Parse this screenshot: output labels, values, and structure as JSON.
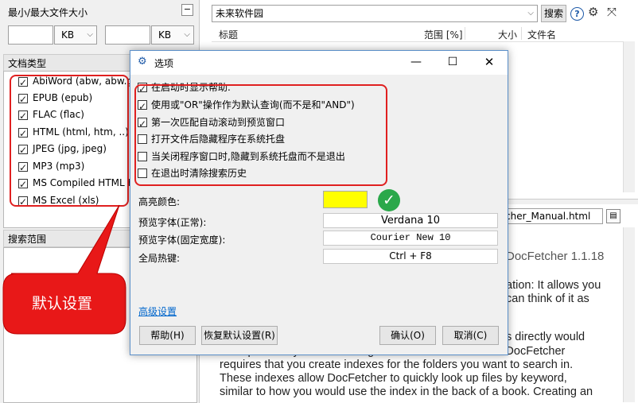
{
  "left": {
    "filesize_title": "最小/最大文件大小",
    "min_unit": "KB",
    "max_unit": "KB",
    "filetype_title": "文档类型",
    "filetypes": [
      {
        "label": "AbiWord (abw, abw.gz"
      },
      {
        "label": "EPUB (epub)"
      },
      {
        "label": "FLAC (flac)"
      },
      {
        "label": "HTML (html, htm, ..)"
      },
      {
        "label": "JPEG (jpg, jpeg)"
      },
      {
        "label": "MP3 (mp3)"
      },
      {
        "label": "MS Compiled HTML H"
      },
      {
        "label": "MS Excel (xls)"
      }
    ],
    "scope_title": "搜索范围"
  },
  "callout": {
    "text": "默认设置"
  },
  "search": {
    "query": "未来软件园",
    "button": "搜索",
    "help_icon": "?",
    "columns": {
      "title": "标题",
      "score": "范围 [%]",
      "size": "大小",
      "filename": "文件名"
    }
  },
  "preview": {
    "filename": "cher_Manual.html",
    "title_fragment": "DocFetcher 1.1.18",
    "lines": [
      "ation: It allows you",
      "can think of it as",
      "s directly would",
      "be impractically slow for a larger number of documents. DocFetcher",
      "requires that you create indexes for the folders you want to search in.",
      "These indexes allow DocFetcher to quickly look up files by keyword,",
      "similar to how you would use the index in the back of a book. Creating an"
    ]
  },
  "dialog": {
    "title": "选项",
    "options": [
      {
        "label": "在启动时显示帮助.",
        "checked": true
      },
      {
        "label": "使用或\"OR\"操作作为默认查询(而不是和\"AND\")",
        "checked": true
      },
      {
        "label": "第一次匹配自动滚动到预览窗口",
        "checked": true
      },
      {
        "label": "打开文件后隐藏程序在系统托盘",
        "checked": false
      },
      {
        "label": "当关闭程序窗口时,隐藏到系统托盘而不是退出",
        "checked": false
      },
      {
        "label": "在退出时清除搜索历史",
        "checked": false
      }
    ],
    "highlight_label": "高亮颜色:",
    "highlight_color": "#ffff00",
    "font_normal_label": "预览字体(正常):",
    "font_normal_value": "Verdana 10",
    "font_fixed_label": "预览字体(固定宽度):",
    "font_fixed_value": "Courier New 10",
    "hotkey_label": "全局热键:",
    "hotkey_value": "Ctrl + F8",
    "advanced_link": "高级设置",
    "help_button": "帮助(H)",
    "restore_button": "恢复默认设置(R)",
    "ok_button": "确认(O)",
    "cancel_button": "取消(C)"
  },
  "colors": {
    "accent_red": "#e02020",
    "callout_red": "#e81818",
    "check_green": "#2aa84a",
    "link_blue": "#0066cc"
  }
}
